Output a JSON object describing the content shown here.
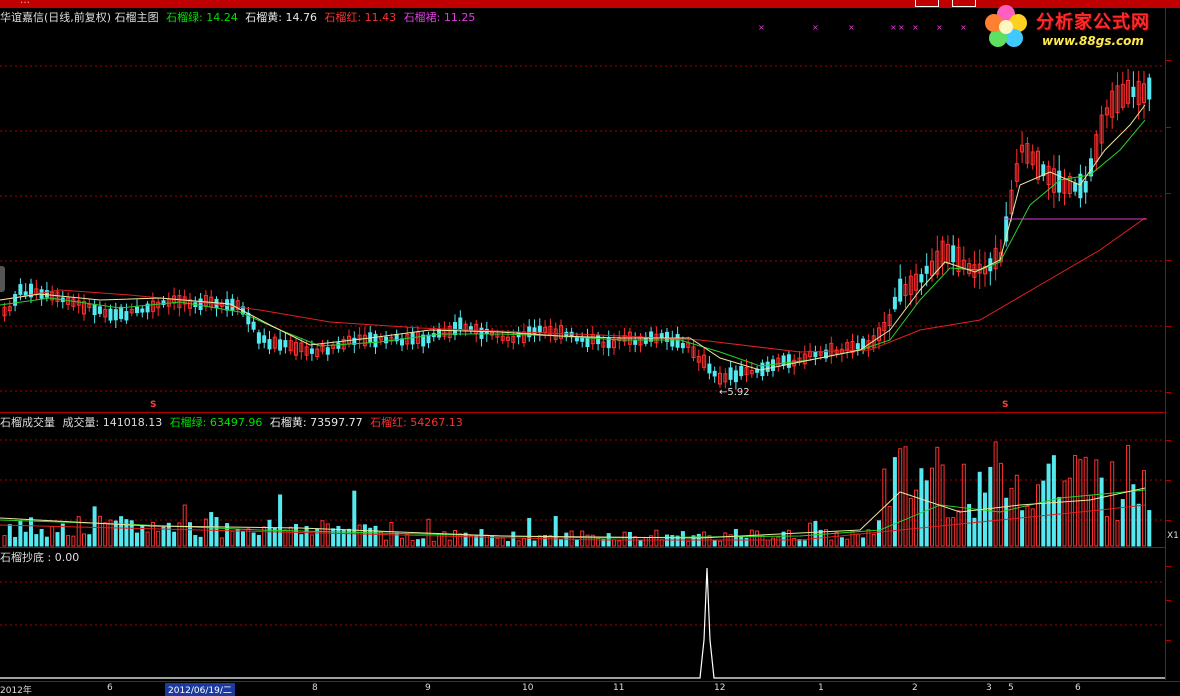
{
  "titlebar": {
    "text": "…"
  },
  "main": {
    "header": {
      "stock": "华谊嘉信(日线,前复权) 石榴主图",
      "ind": [
        {
          "label": "石榴绿: 14.24",
          "color": "#00e000"
        },
        {
          "label": "石榴黄: 14.76",
          "color": "#e8e8e8"
        },
        {
          "label": "石榴红: 11.43",
          "color": "#ff3030"
        },
        {
          "label": "石榴裙: 11.25",
          "color": "#e040e0"
        }
      ]
    },
    "min_label": "←5.92",
    "s_mark": "S"
  },
  "volume": {
    "header": {
      "name": "石榴成交量",
      "vol": "成交量: 141018.13",
      "ind": [
        {
          "label": "石榴绿: 63497.96",
          "color": "#00e000"
        },
        {
          "label": "石榴黄: 73597.77",
          "color": "#e8e8e8"
        },
        {
          "label": "石榴红: 54267.13",
          "color": "#ff3030"
        }
      ]
    },
    "scale_label": "X1"
  },
  "osc": {
    "header": "石榴抄底 : 0.00"
  },
  "logo": {
    "name": "分析家公式网",
    "url": "www.88gs.com"
  },
  "timeaxis": {
    "labels": [
      "2012年",
      "6",
      "2012/06/19/二",
      "8",
      "9",
      "10",
      "11",
      "12",
      "1",
      "2",
      "3",
      "5",
      "6"
    ],
    "selected": 2
  },
  "colors": {
    "up": "#ff3030",
    "down": "#54e8f0",
    "ma_red": "#e02020",
    "ma_green": "#28d028",
    "ma_yellow": "#e8e8a0",
    "grid": "#b00000"
  }
}
